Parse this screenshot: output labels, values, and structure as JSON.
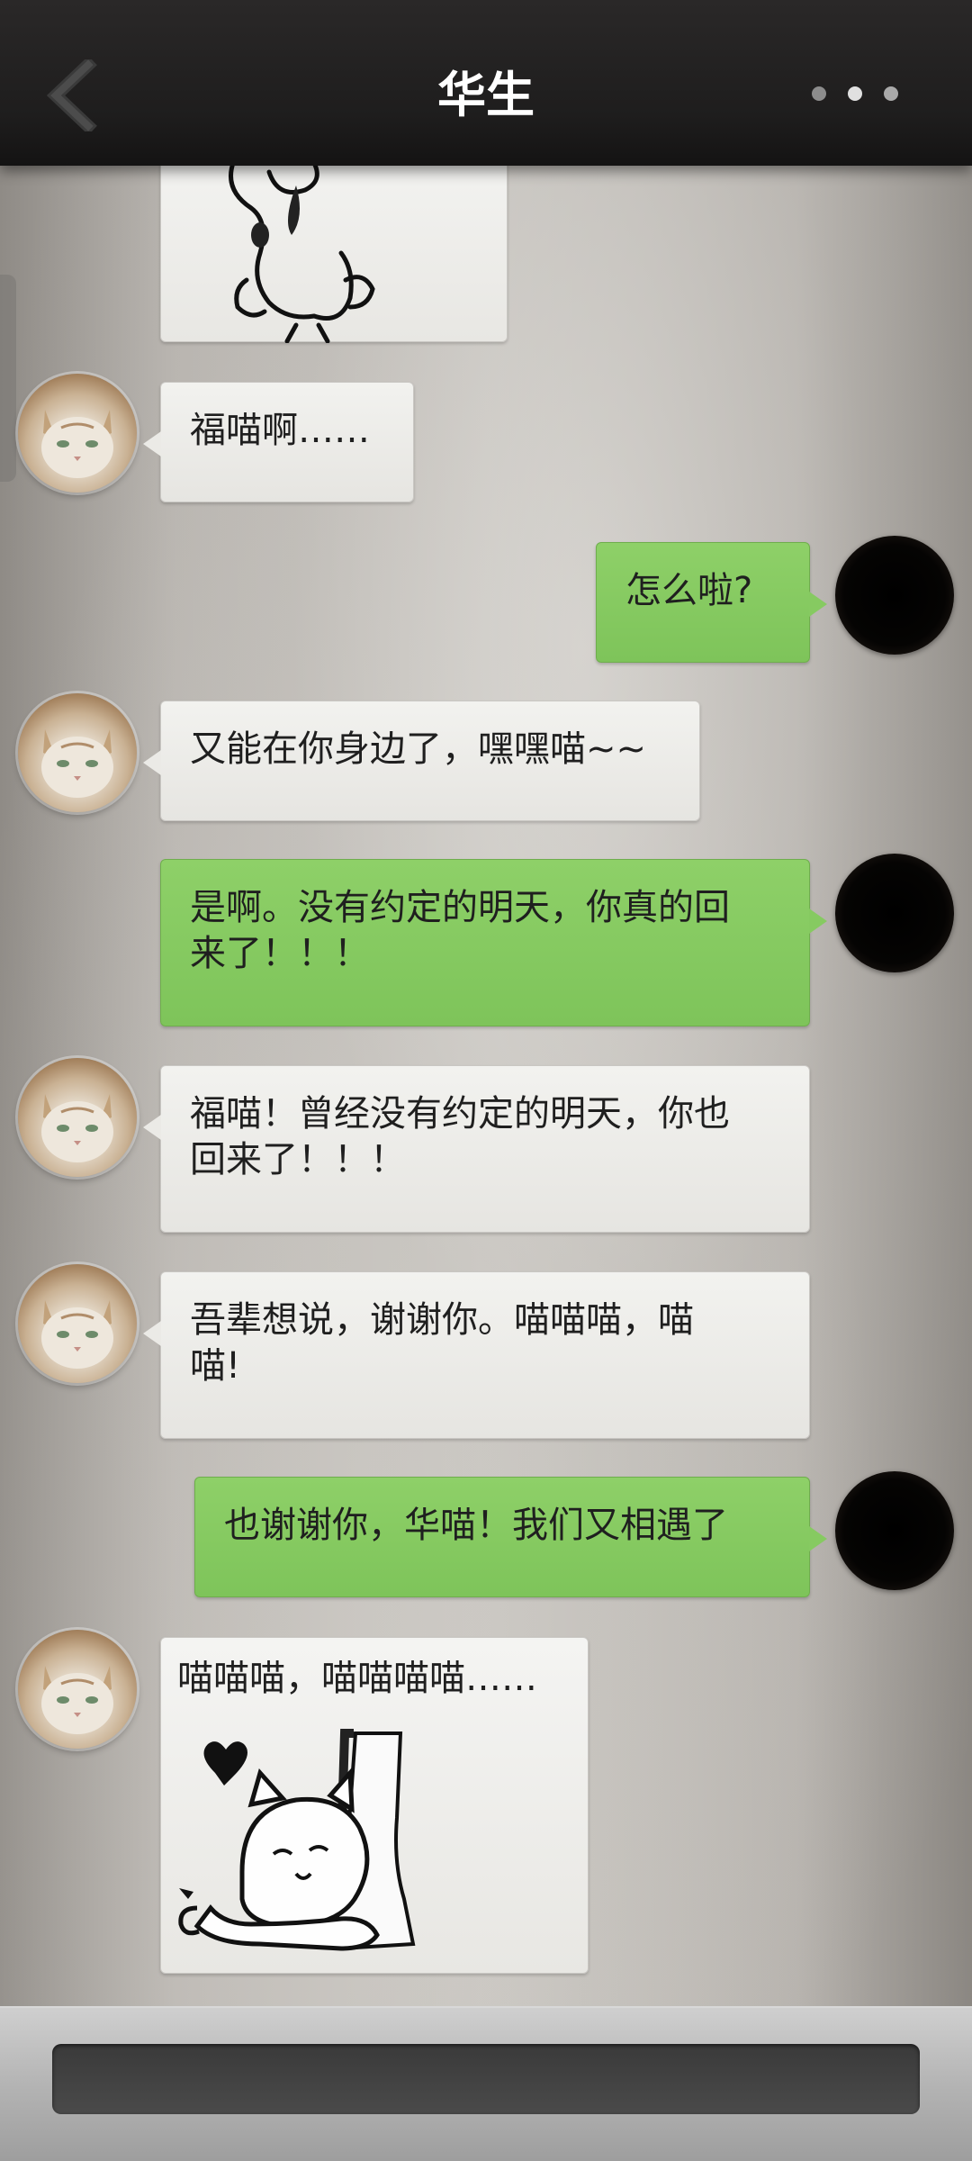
{
  "header": {
    "title": "华生",
    "back_icon": "chevron-left-icon",
    "more_icon": "more-dots-icon"
  },
  "contact": {
    "avatar_icon": "cat-avatar",
    "self_avatar_icon": "self-avatar"
  },
  "messages": [
    {
      "from": "contact",
      "type": "sticker",
      "text": ""
    },
    {
      "from": "contact",
      "type": "text",
      "text": "福喵啊……"
    },
    {
      "from": "self",
      "type": "text",
      "text": "怎么啦?"
    },
    {
      "from": "contact",
      "type": "text",
      "text": "又能在你身边了，嘿嘿喵~~"
    },
    {
      "from": "self",
      "type": "text",
      "lines": [
        "是啊。没有约定的明天，你真的回",
        "来了！！！"
      ]
    },
    {
      "from": "contact",
      "type": "text",
      "lines": [
        "福喵！曾经没有约定的明天，你也",
        "回来了！！！"
      ]
    },
    {
      "from": "contact",
      "type": "text",
      "lines": [
        "吾辈想说，谢谢你。喵喵喵，喵",
        "喵!"
      ]
    },
    {
      "from": "self",
      "type": "text",
      "text": "也谢谢你，华喵！我们又相遇了"
    },
    {
      "from": "contact",
      "type": "sticker",
      "text": "喵喵喵，喵喵喵喵……"
    }
  ],
  "colors": {
    "header_bg": "#1e1d1d",
    "bubble_out": "#86ca61",
    "bubble_in": "#ebeae6",
    "input_bg": "#414141"
  },
  "input": {
    "placeholder": ""
  }
}
